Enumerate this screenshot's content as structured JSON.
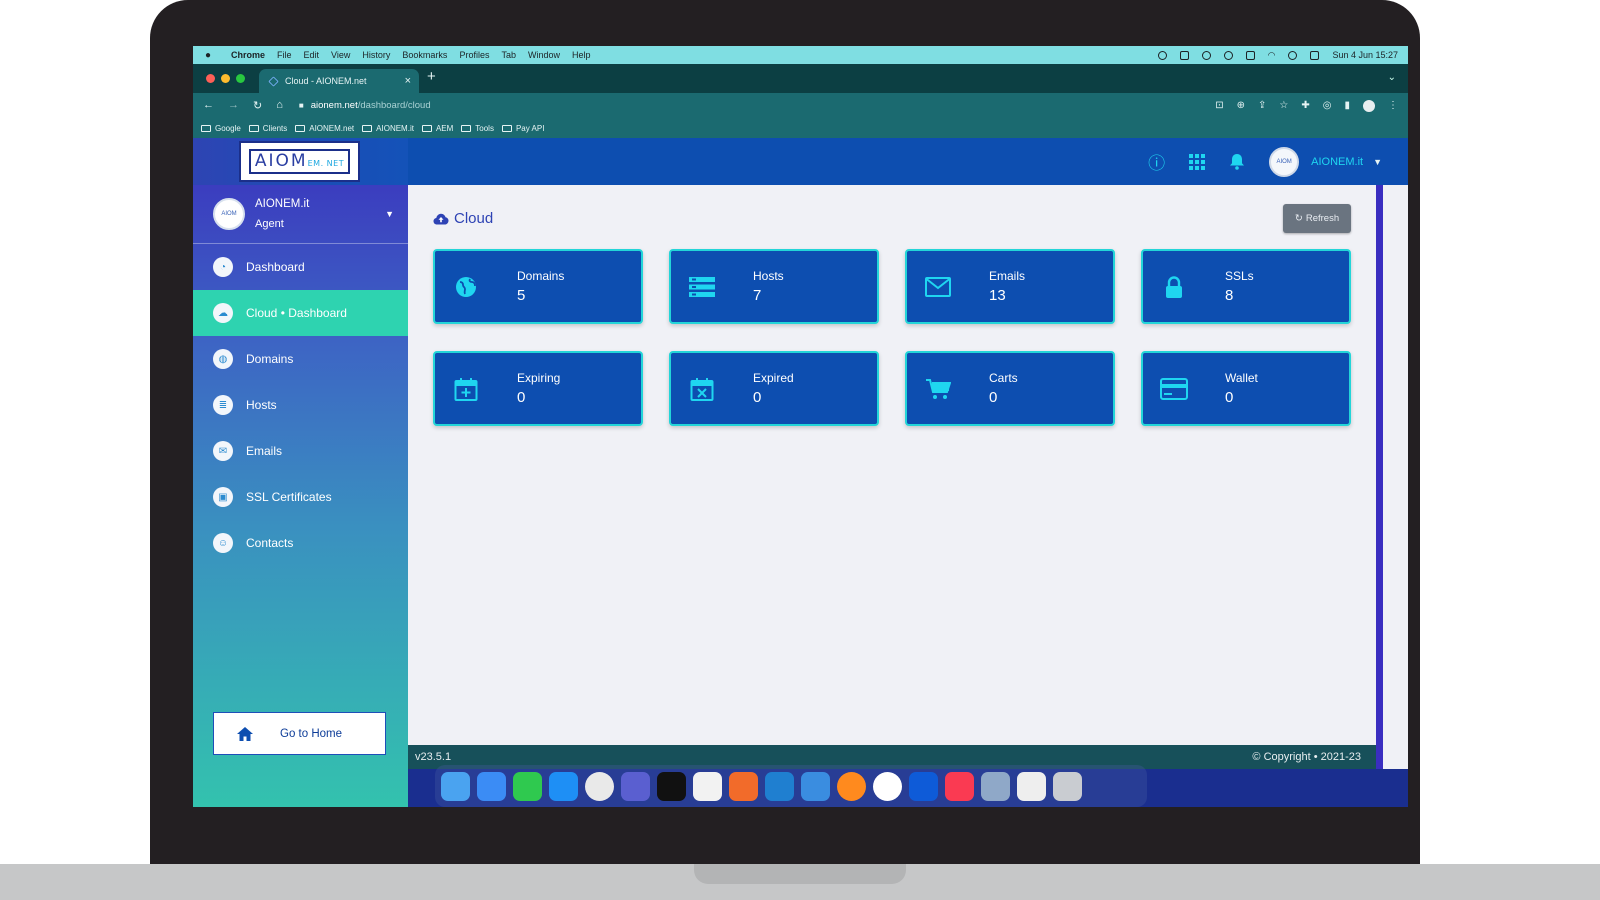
{
  "menubar": {
    "app": "Chrome",
    "items": [
      "File",
      "Edit",
      "View",
      "History",
      "Bookmarks",
      "Profiles",
      "Tab",
      "Window",
      "Help"
    ],
    "clock": "Sun 4 Jun  15:27"
  },
  "browser": {
    "tab_title": "Cloud - AIONEM.net",
    "url_host": "aionem.net",
    "url_path": "/dashboard/cloud",
    "bookmarks": [
      "Google",
      "Clients",
      "AIONEM.net",
      "AIONEM.it",
      "AEM",
      "Tools",
      "Pay API"
    ]
  },
  "logo": {
    "main": "AIOM",
    "sub": "EM. NET"
  },
  "topnav": {
    "username": "AIONEM.it",
    "avatar_text": "AIOM"
  },
  "sidebar": {
    "profile": {
      "name": "AIONEM.it",
      "role": "Agent",
      "avatar_text": "AIOM"
    },
    "items": [
      {
        "label": "Dashboard",
        "icon": "dashboard-icon",
        "active": false
      },
      {
        "label": "Cloud • Dashboard",
        "icon": "cloud-icon",
        "active": true
      },
      {
        "label": "Domains",
        "icon": "globe-icon",
        "active": false
      },
      {
        "label": "Hosts",
        "icon": "server-icon",
        "active": false
      },
      {
        "label": "Emails",
        "icon": "envelope-icon",
        "active": false
      },
      {
        "label": "SSL Certificates",
        "icon": "lock-icon",
        "active": false
      },
      {
        "label": "Contacts",
        "icon": "contact-icon",
        "active": false
      }
    ],
    "go_home": "Go to Home"
  },
  "page": {
    "title": "Cloud",
    "refresh_label": "Refresh",
    "cards": [
      {
        "label": "Domains",
        "value": "5",
        "icon": "globe-icon"
      },
      {
        "label": "Hosts",
        "value": "7",
        "icon": "server-icon"
      },
      {
        "label": "Emails",
        "value": "13",
        "icon": "envelope-icon"
      },
      {
        "label": "SSLs",
        "value": "8",
        "icon": "lock-icon"
      },
      {
        "label": "Expiring",
        "value": "0",
        "icon": "calendar-plus-icon"
      },
      {
        "label": "Expired",
        "value": "0",
        "icon": "calendar-x-icon"
      },
      {
        "label": "Carts",
        "value": "0",
        "icon": "cart-icon"
      },
      {
        "label": "Wallet",
        "value": "0",
        "icon": "credit-card-icon"
      }
    ]
  },
  "footer": {
    "version": "v23.5.1",
    "copyright": "© Copyright • 2021-23"
  },
  "colors": {
    "primary": "#0d4eb0",
    "accent": "#1fd6f0",
    "active_menu": "#2ed3b0"
  }
}
